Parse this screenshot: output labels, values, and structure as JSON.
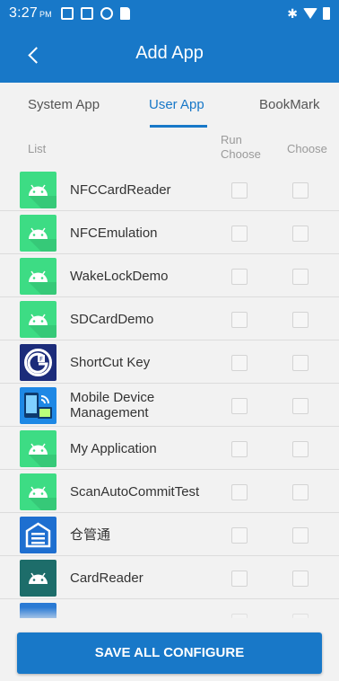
{
  "status_bar": {
    "time": "3:27",
    "ampm": "PM"
  },
  "header": {
    "title": "Add App"
  },
  "tabs": [
    {
      "label": "System App",
      "active": false
    },
    {
      "label": "User App",
      "active": true
    },
    {
      "label": "BookMark",
      "active": false
    }
  ],
  "columns": {
    "list": "List",
    "run_choose_line1": "Run",
    "run_choose_line2": "Choose",
    "choose": "Choose"
  },
  "apps": [
    {
      "name": "NFCCardReader",
      "icon": "android-icon",
      "run_checked": false,
      "choose_checked": false
    },
    {
      "name": "NFCEmulation",
      "icon": "android-icon",
      "run_checked": false,
      "choose_checked": false
    },
    {
      "name": "WakeLockDemo",
      "icon": "android-icon",
      "run_checked": false,
      "choose_checked": false
    },
    {
      "name": "SDCardDemo",
      "icon": "android-icon",
      "run_checked": false,
      "choose_checked": false
    },
    {
      "name": "ShortCut Key",
      "icon": "shortcut-key-icon",
      "run_checked": false,
      "choose_checked": false
    },
    {
      "name_line1": "Mobile Device",
      "name_line2": "Management",
      "icon": "mdm-icon",
      "run_checked": false,
      "choose_checked": false
    },
    {
      "name": "My Application",
      "icon": "android-icon",
      "run_checked": false,
      "choose_checked": false
    },
    {
      "name": "ScanAutoCommitTest",
      "icon": "android-icon",
      "run_checked": false,
      "choose_checked": false
    },
    {
      "name": "仓管通",
      "icon": "warehouse-icon",
      "run_checked": false,
      "choose_checked": false
    },
    {
      "name": "CardReader",
      "icon": "android-icon",
      "run_checked": false,
      "choose_checked": false
    }
  ],
  "save_button": "SAVE ALL CONFIGURE",
  "colors": {
    "primary": "#1878c8",
    "android_green": "#3ddc84",
    "background": "#f2f2f2"
  }
}
